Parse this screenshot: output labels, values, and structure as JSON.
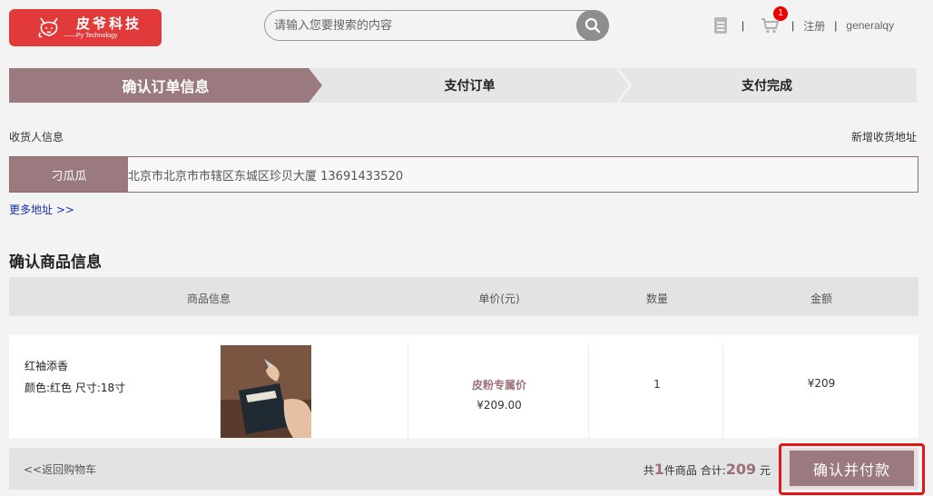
{
  "header": {
    "logo_title": "皮爷科技",
    "logo_subtitle": "——Py Technology",
    "search_placeholder": "请输入您要搜索的内容",
    "cart_count": "1",
    "nav_sep": "|",
    "register_label": "注册",
    "username": "generalqy"
  },
  "steps": [
    {
      "label": "确认订单信息",
      "active": true
    },
    {
      "label": "支付订单",
      "active": false
    },
    {
      "label": "支付完成",
      "active": false
    }
  ],
  "address": {
    "section_label": "收货人信息",
    "add_label": "新增收货地址",
    "name": "刁瓜瓜",
    "detail": "北京市北京市市辖区东城区珍贝大厦  13691433520",
    "more_label": "更多地址 >>"
  },
  "goods": {
    "title": "确认商品信息",
    "columns": [
      "商品信息",
      "单价(元)",
      "数量",
      "金额"
    ],
    "items": [
      {
        "name": "红袖添香",
        "spec": "颜色:红色  尺寸:18寸",
        "price_tag": "皮粉专属价",
        "price": "¥209.00",
        "qty": "1",
        "amount": "¥209"
      }
    ]
  },
  "footer": {
    "back_label": "<<返回购物车",
    "total_prefix": "共",
    "total_count": "1",
    "total_mid": "件商品  合计:",
    "total_amount": "209",
    "total_unit": " 元",
    "pay_label": "确认并付款"
  },
  "colors": {
    "brand_red": "#e23a3a",
    "accent": "#9b7a7f",
    "highlight_outline": "#e01818"
  }
}
